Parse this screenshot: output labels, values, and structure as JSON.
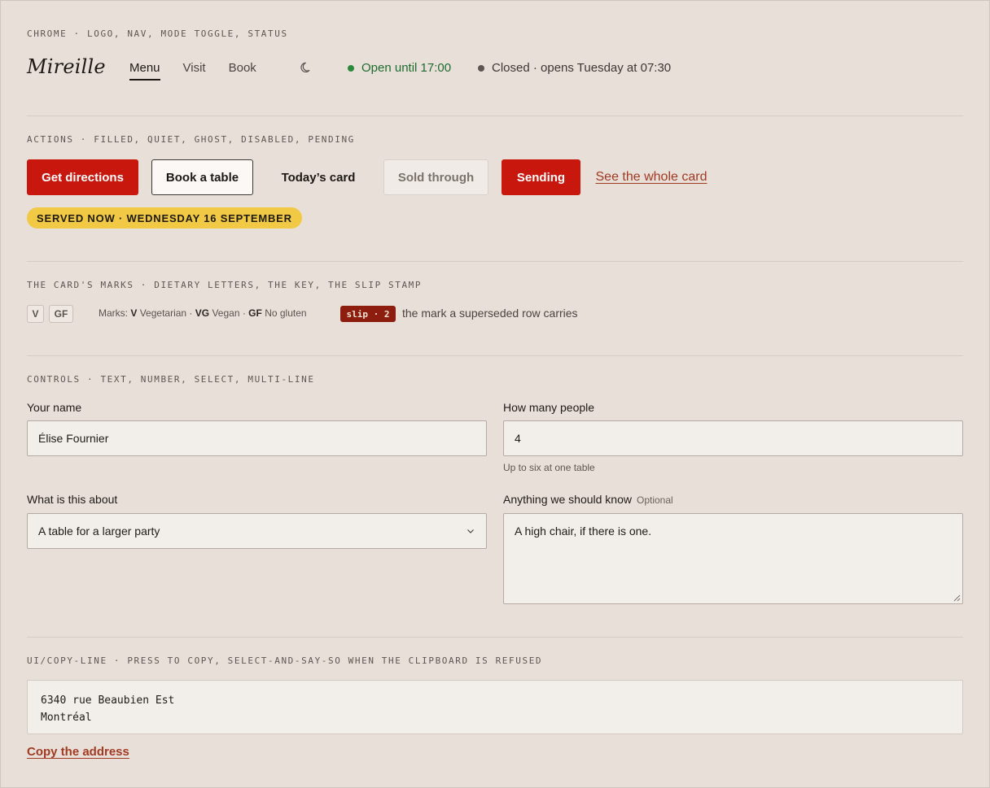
{
  "sections": {
    "chrome": "CHROME · LOGO, NAV, MODE TOGGLE, STATUS",
    "actions": "ACTIONS · FILLED, QUIET, GHOST, DISABLED, PENDING",
    "marks": "THE CARD'S MARKS · DIETARY LETTERS, THE KEY, THE SLIP STAMP",
    "controls": "CONTROLS · TEXT, NUMBER, SELECT, MULTI-LINE",
    "copy_line": "UI/COPY-LINE · PRESS TO COPY, SELECT-AND-SAY-SO WHEN THE CLIPBOARD IS REFUSED"
  },
  "header": {
    "logo": "Mireille",
    "nav": [
      {
        "label": "Menu",
        "active": true
      },
      {
        "label": "Visit",
        "active": false
      },
      {
        "label": "Book",
        "active": false
      }
    ],
    "mode_toggle_icon": "moon-icon",
    "status_open": "Open until 17:00",
    "status_closed": "Closed · opens Tuesday at 07:30",
    "colors": {
      "open": "#2a8a3c",
      "closed": "#5d5650"
    }
  },
  "actions": {
    "filled": "Get directions",
    "quiet": "Book a table",
    "ghost": "Today’s card",
    "disabled": "Sold through",
    "pending": "Sending",
    "link": "See the whole card",
    "served_badge": "SERVED NOW · WEDNESDAY 16 SEPTEMBER",
    "colors": {
      "primary": "#c8170d",
      "badge": "#f1c944",
      "link": "#a13a22"
    }
  },
  "marks": {
    "chips": [
      "V",
      "GF"
    ],
    "key_prefix": "Marks:",
    "key": [
      {
        "code": "V",
        "meaning": "Vegetarian"
      },
      {
        "code": "VG",
        "meaning": "Vegan"
      },
      {
        "code": "GF",
        "meaning": "No gluten"
      }
    ],
    "slip_stamp": "slip · 2",
    "slip_description": "the mark a superseded row carries"
  },
  "controls": {
    "name": {
      "label": "Your name",
      "value": "Élise Fournier"
    },
    "people": {
      "label": "How many people",
      "value": "4",
      "hint": "Up to six at one table"
    },
    "topic": {
      "label": "What is this about",
      "value": "A table for a larger party"
    },
    "notes": {
      "label": "Anything we should know",
      "optional": "Optional",
      "value": "A high chair, if there is one."
    }
  },
  "copy_line": {
    "address_line_1": "6340 rue Beaubien Est",
    "address_line_2": "Montréal",
    "button": "Copy the address"
  }
}
